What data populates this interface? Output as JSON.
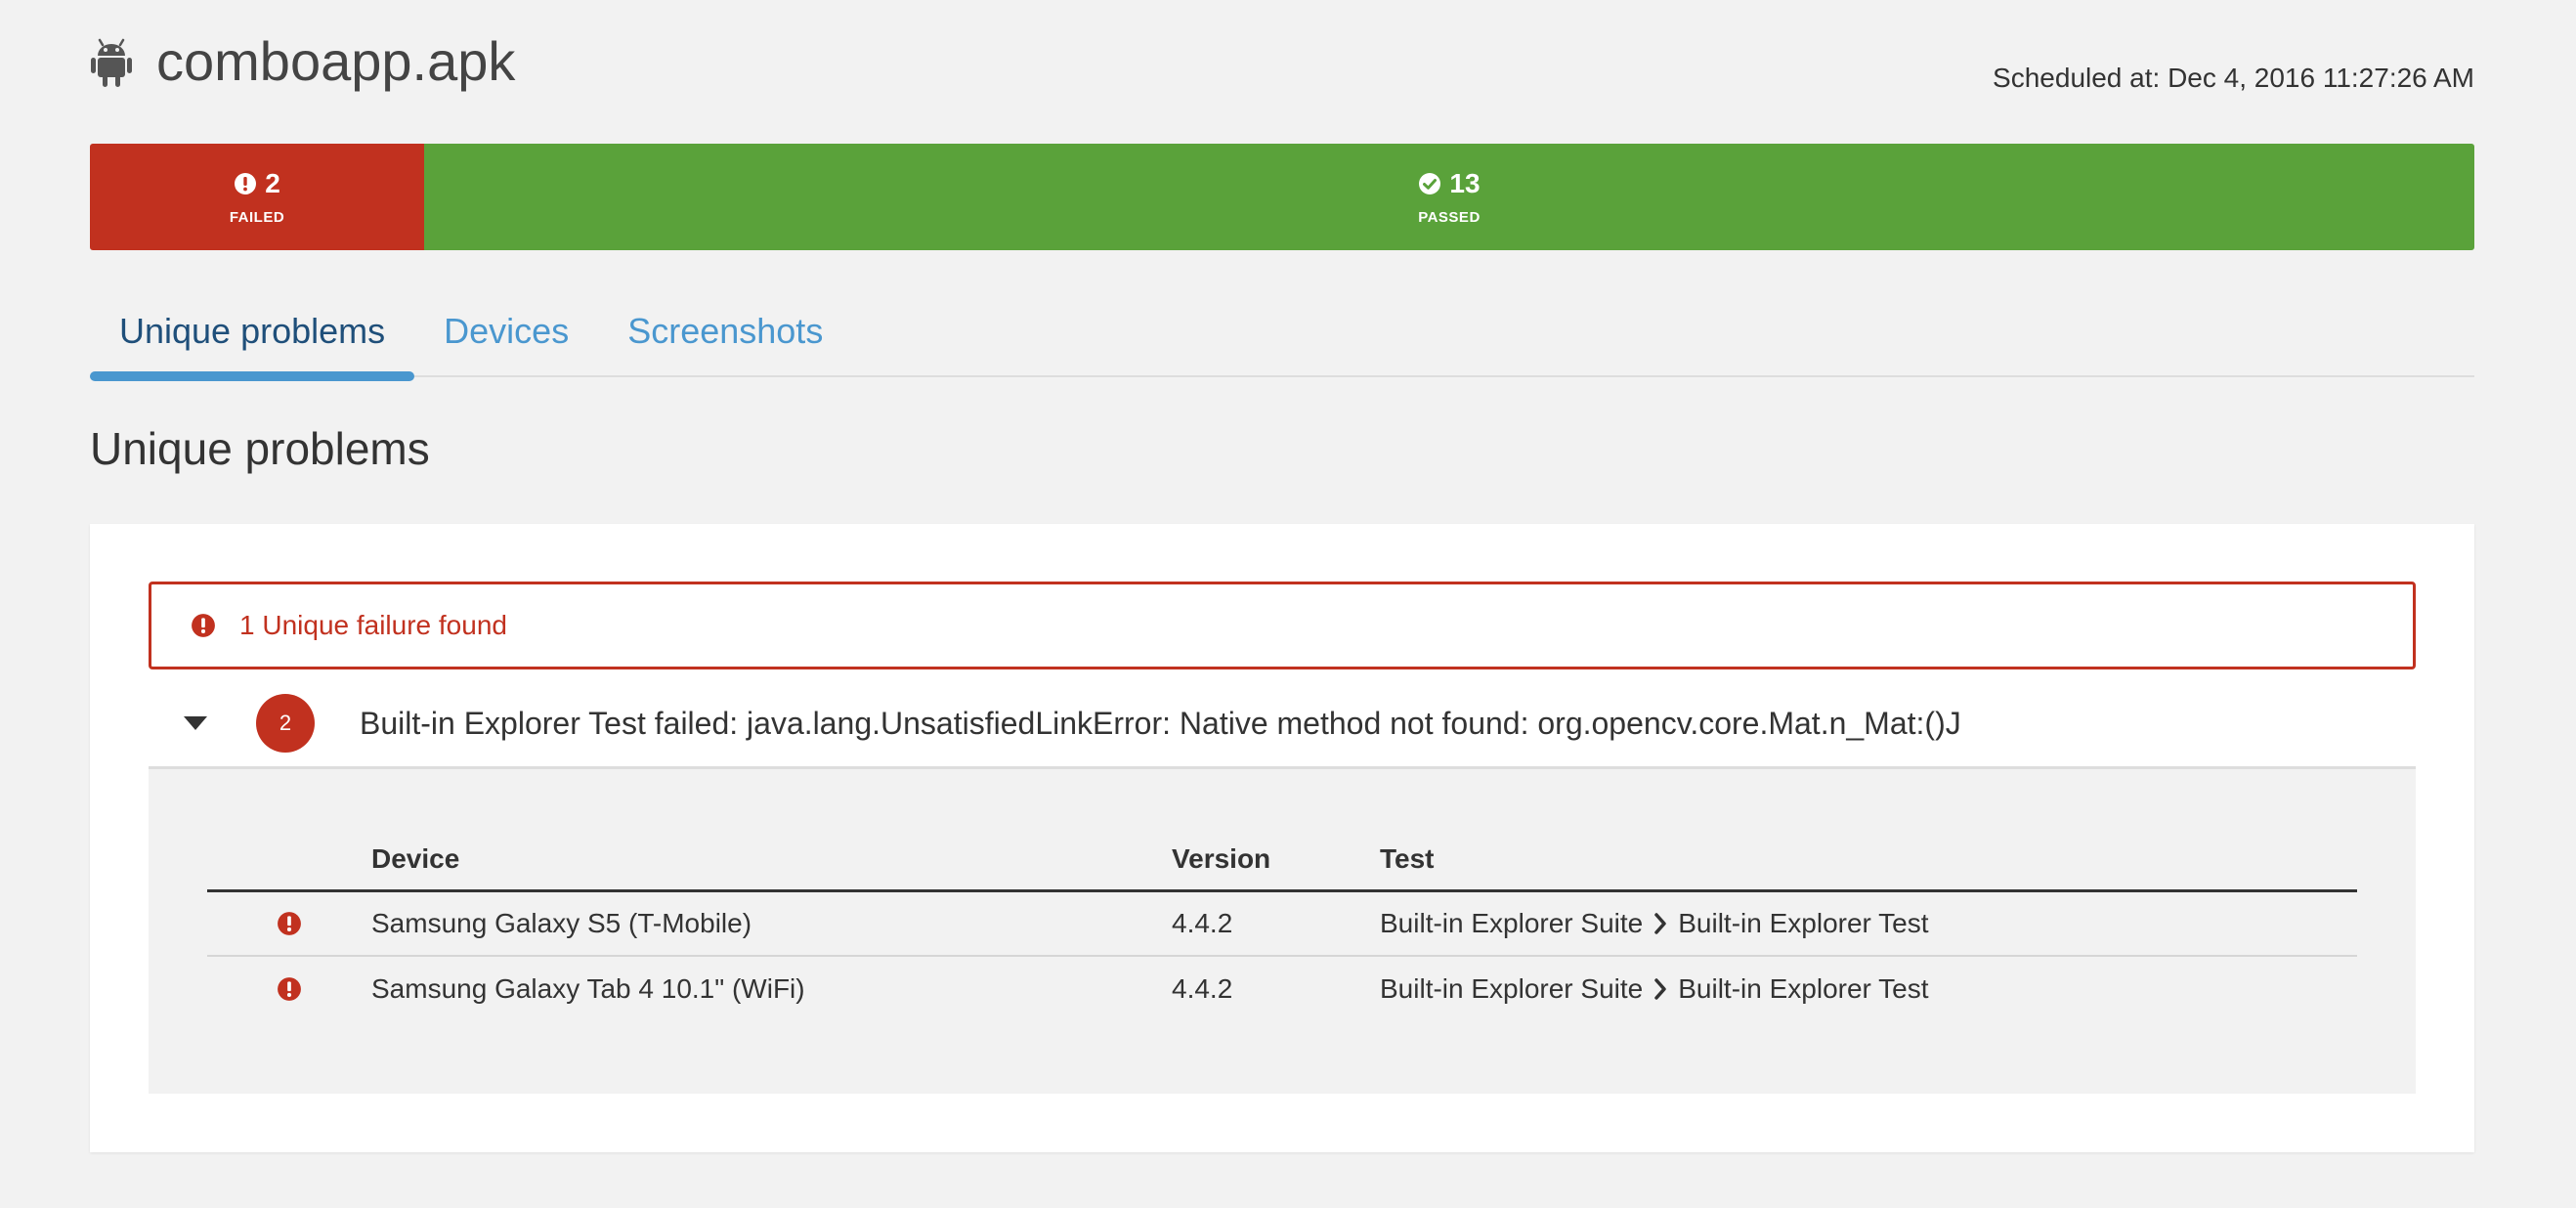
{
  "header": {
    "app_name": "comboapp.apk",
    "scheduled_text": "Scheduled at: Dec 4, 2016 11:27:26 AM"
  },
  "status": {
    "failed_count": "2",
    "failed_label": "FAILED",
    "passed_count": "13",
    "passed_label": "PASSED",
    "failed_color": "#c1311f",
    "passed_color": "#5aa23a"
  },
  "tabs": [
    {
      "label": "Unique problems",
      "active": true
    },
    {
      "label": "Devices",
      "active": false
    },
    {
      "label": "Screenshots",
      "active": false
    }
  ],
  "section_title": "Unique problems",
  "alert": {
    "text": "1 Unique failure found",
    "icon": "exclamation-circle-icon"
  },
  "problem": {
    "count": "2",
    "text": "Built-in Explorer Test failed: java.lang.UnsatisfiedLinkError: Native method not found: org.opencv.core.Mat.n_Mat:()J",
    "expanded": true
  },
  "details": {
    "columns": [
      "Device",
      "Version",
      "Test"
    ],
    "rows": [
      {
        "device": "Samsung Galaxy S5 (T-Mobile)",
        "version": "4.4.2",
        "suite": "Built-in Explorer Suite",
        "test": "Built-in Explorer Test"
      },
      {
        "device": "Samsung Galaxy Tab 4 10.1\" (WiFi)",
        "version": "4.4.2",
        "suite": "Built-in Explorer Suite",
        "test": "Built-in Explorer Test"
      }
    ]
  }
}
